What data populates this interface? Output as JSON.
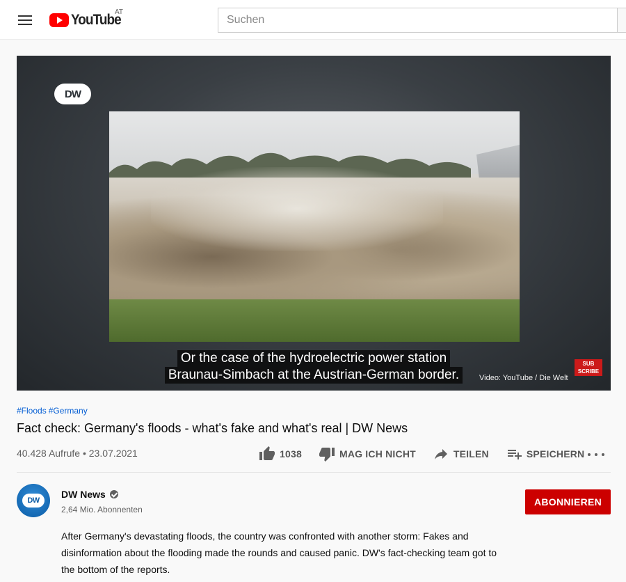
{
  "masthead": {
    "logo_text": "YouTube",
    "country_code": "AT",
    "search_placeholder": "Suchen"
  },
  "player": {
    "watermark": "DW",
    "subtitle_lines": [
      "Or the case of the hydroelectric power station",
      "Braunau-Simbach at the Austrian-German border."
    ],
    "credit": "Video: YouTube / Die Welt",
    "subscribe_badge": [
      "SUB",
      "SCRIBE"
    ]
  },
  "video": {
    "hashtags": [
      "#Floods",
      "#Germany"
    ],
    "title": "Fact check: Germany's floods - what's fake and what's real | DW News",
    "views": "40.428 Aufrufe",
    "date": "23.07.2021"
  },
  "actions": {
    "like_count": "1038",
    "dislike_label": "MAG ICH NICHT",
    "share_label": "TEILEN",
    "save_label": "SPEICHERN"
  },
  "channel": {
    "avatar_text": "DW",
    "name": "DW News",
    "subscribers": "2,64 Mio. Abonnenten",
    "subscribe_label": "ABONNIEREN"
  },
  "description": "After Germany's devastating floods, the country was confronted with another storm: Fakes and disinformation about the flooding made the rounds and caused panic. DW's fact-checking team got to the bottom of the reports.",
  "colors": {
    "brand_red": "#ff0000",
    "subscribe_red": "#cc0000",
    "link_blue": "#065fd4"
  }
}
